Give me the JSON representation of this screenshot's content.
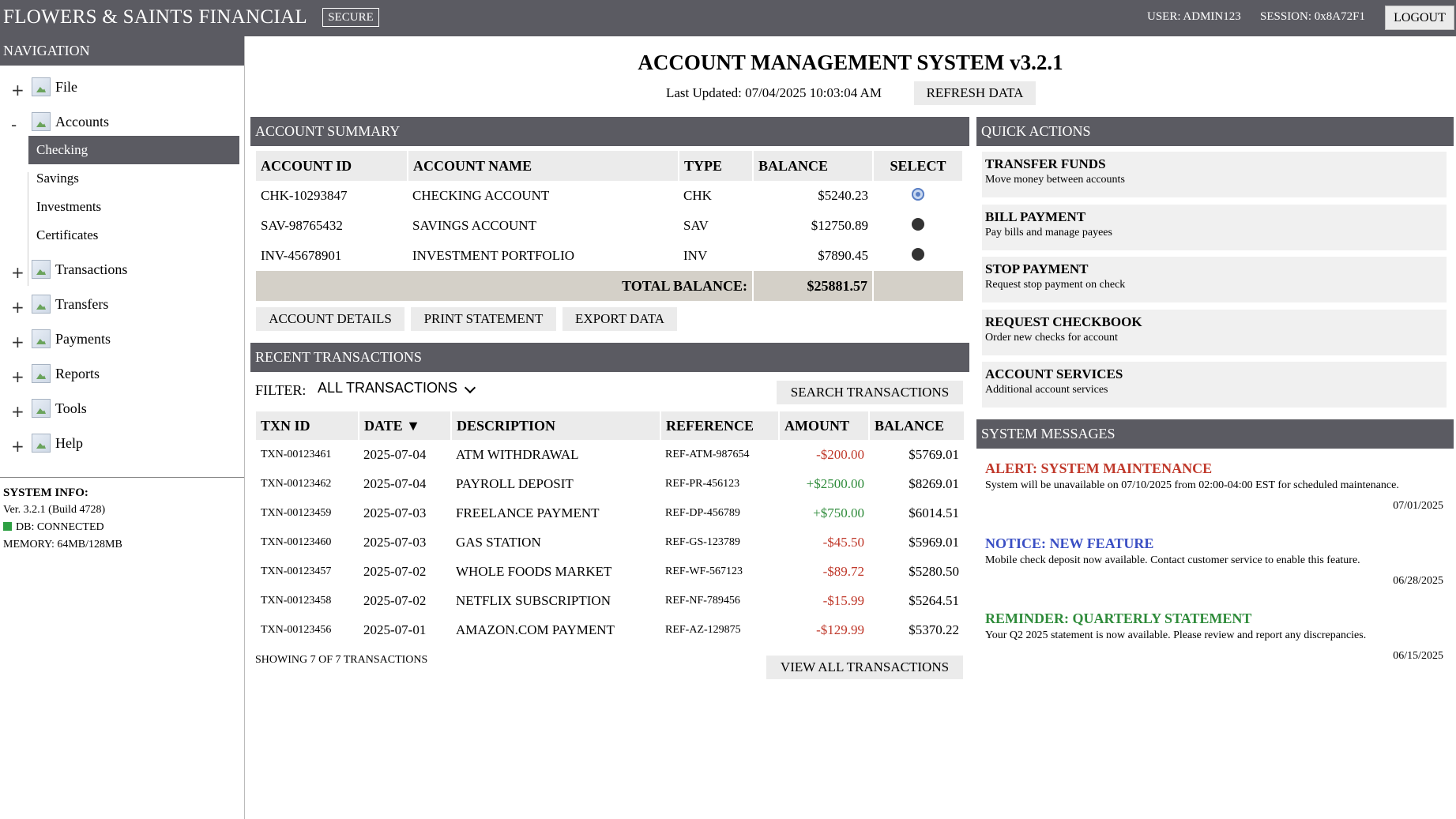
{
  "topbar": {
    "brand": "FLOWERS & SAINTS FINANCIAL",
    "secure": "SECURE",
    "user": "USER: ADMIN123",
    "session": "SESSION: 0x8A72F1",
    "logout": "LOGOUT"
  },
  "nav": {
    "header": "NAVIGATION",
    "items": [
      {
        "toggle": "+",
        "label": "File"
      },
      {
        "toggle": "-",
        "label": "Accounts"
      },
      {
        "toggle": "+",
        "label": "Transactions"
      },
      {
        "toggle": "+",
        "label": "Transfers"
      },
      {
        "toggle": "+",
        "label": "Payments"
      },
      {
        "toggle": "+",
        "label": "Reports"
      },
      {
        "toggle": "+",
        "label": "Tools"
      },
      {
        "toggle": "+",
        "label": "Help"
      }
    ],
    "accounts_children": [
      "Checking",
      "Savings",
      "Investments",
      "Certificates"
    ],
    "active_child": "Checking"
  },
  "system_info": {
    "title": "SYSTEM INFO:",
    "version": "Ver. 3.2.1 (Build 4728)",
    "db": "DB: CONNECTED",
    "memory": "MEMORY: 64MB/128MB",
    "db_color": "#2ea043"
  },
  "main": {
    "title": "ACCOUNT MANAGEMENT SYSTEM v3.2.1",
    "last_updated": "Last Updated: 07/04/2025 10:03:04 AM",
    "refresh": "REFRESH DATA"
  },
  "account_summary": {
    "header": "ACCOUNT SUMMARY",
    "columns": [
      "ACCOUNT ID",
      "ACCOUNT NAME",
      "TYPE",
      "BALANCE",
      "SELECT"
    ],
    "rows": [
      {
        "id": "CHK-10293847",
        "name": "CHECKING ACCOUNT",
        "type": "CHK",
        "balance": "$5240.23",
        "selected": true
      },
      {
        "id": "SAV-98765432",
        "name": "SAVINGS ACCOUNT",
        "type": "SAV",
        "balance": "$12750.89",
        "selected": false
      },
      {
        "id": "INV-45678901",
        "name": "INVESTMENT PORTFOLIO",
        "type": "INV",
        "balance": "$7890.45",
        "selected": false
      }
    ],
    "total_label": "TOTAL BALANCE:",
    "total_value": "$25881.57",
    "buttons": {
      "details": "ACCOUNT DETAILS",
      "print": "PRINT STATEMENT",
      "export": "EXPORT DATA"
    }
  },
  "recent_transactions": {
    "header": "RECENT TRANSACTIONS",
    "filter_label": "FILTER:",
    "filter_value": "ALL TRANSACTIONS",
    "search_button": "SEARCH TRANSACTIONS",
    "columns": [
      "TXN ID",
      "DATE ▼",
      "DESCRIPTION",
      "REFERENCE",
      "AMOUNT",
      "BALANCE"
    ],
    "rows": [
      {
        "id": "TXN-00123461",
        "date": "2025-07-04",
        "desc": "ATM WITHDRAWAL",
        "ref": "REF-ATM-987654",
        "amount": "-$200.00",
        "balance": "$5769.01"
      },
      {
        "id": "TXN-00123462",
        "date": "2025-07-04",
        "desc": "PAYROLL DEPOSIT",
        "ref": "REF-PR-456123",
        "amount": "+$2500.00",
        "balance": "$8269.01"
      },
      {
        "id": "TXN-00123459",
        "date": "2025-07-03",
        "desc": "FREELANCE PAYMENT",
        "ref": "REF-DP-456789",
        "amount": "+$750.00",
        "balance": "$6014.51"
      },
      {
        "id": "TXN-00123460",
        "date": "2025-07-03",
        "desc": "GAS STATION",
        "ref": "REF-GS-123789",
        "amount": "-$45.50",
        "balance": "$5969.01"
      },
      {
        "id": "TXN-00123457",
        "date": "2025-07-02",
        "desc": "WHOLE FOODS MARKET",
        "ref": "REF-WF-567123",
        "amount": "-$89.72",
        "balance": "$5280.50"
      },
      {
        "id": "TXN-00123458",
        "date": "2025-07-02",
        "desc": "NETFLIX SUBSCRIPTION",
        "ref": "REF-NF-789456",
        "amount": "-$15.99",
        "balance": "$5264.51"
      },
      {
        "id": "TXN-00123456",
        "date": "2025-07-01",
        "desc": "AMAZON.COM PAYMENT",
        "ref": "REF-AZ-129875",
        "amount": "-$129.99",
        "balance": "$5370.22"
      }
    ],
    "showing": "SHOWING 7 OF 7 TRANSACTIONS",
    "view_all": "VIEW ALL TRANSACTIONS"
  },
  "quick_actions": {
    "header": "QUICK ACTIONS",
    "items": [
      {
        "title": "TRANSFER FUNDS",
        "desc": "Move money between accounts"
      },
      {
        "title": "BILL PAYMENT",
        "desc": "Pay bills and manage payees"
      },
      {
        "title": "STOP PAYMENT",
        "desc": "Request stop payment on check"
      },
      {
        "title": "REQUEST CHECKBOOK",
        "desc": "Order new checks for account"
      },
      {
        "title": "ACCOUNT SERVICES",
        "desc": "Additional account services"
      }
    ]
  },
  "system_messages": {
    "header": "SYSTEM MESSAGES",
    "items": [
      {
        "title": "ALERT: SYSTEM MAINTENANCE",
        "text": "System will be unavailable on 07/10/2025 from 02:00-04:00 EST for scheduled maintenance.",
        "date": "07/01/2025",
        "color": "#c0392b"
      },
      {
        "title": "NOTICE: NEW FEATURE",
        "text": "Mobile check deposit now available. Contact customer service to enable this feature.",
        "date": "06/28/2025",
        "color": "#3a4fc4"
      },
      {
        "title": "REMINDER: QUARTERLY STATEMENT",
        "text": "Your Q2 2025 statement is now available. Please review and report any discrepancies.",
        "date": "06/15/2025",
        "color": "#2e8b3a"
      }
    ]
  },
  "colors": {
    "header_bg": "#5b5b62",
    "negative": "#c0392b",
    "positive": "#2e8b3a"
  }
}
